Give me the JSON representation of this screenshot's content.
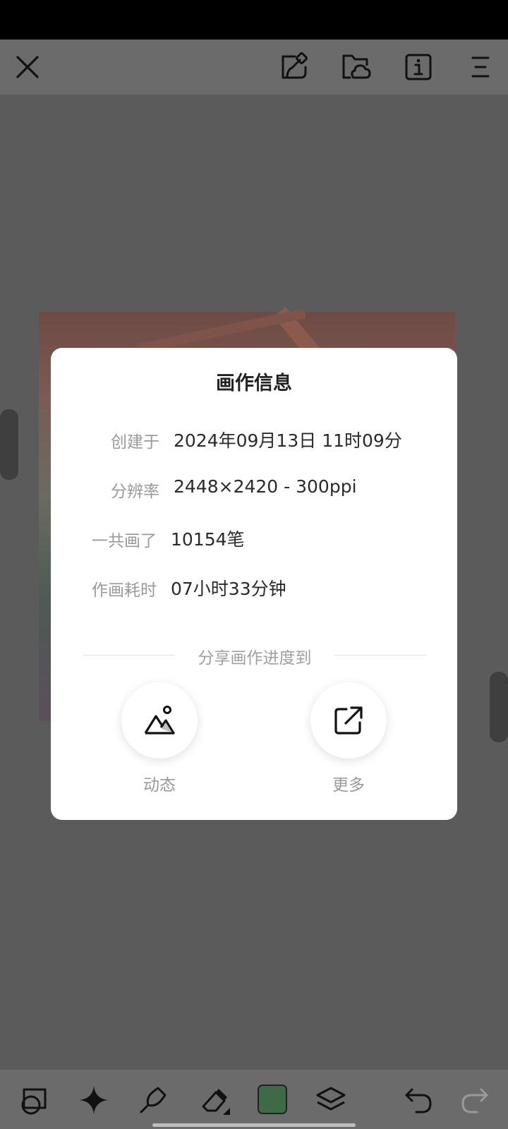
{
  "dialog": {
    "title": "画作信息",
    "rows": [
      {
        "label": "创建于",
        "value": "2024年09月13日 11时09分"
      },
      {
        "label": "分辨率",
        "value": "2448×2420 - 300ppi"
      },
      {
        "label": "一共画了",
        "value": "10154笔"
      },
      {
        "label": "作画耗时",
        "value": "07小时33分钟"
      }
    ],
    "share_heading": "分享画作进度到",
    "share_targets": [
      {
        "label": "动态",
        "icon": "mountain-image-icon"
      },
      {
        "label": "更多",
        "icon": "external-share-icon"
      }
    ]
  },
  "top_bar": {
    "icons": [
      "close-icon",
      "canvas-edit-icon",
      "cloud-folder-icon",
      "info-icon",
      "menu-icon"
    ]
  },
  "bottom_toolbar": {
    "icons": [
      "shapes-icon",
      "sparkle-icon",
      "brush-icon",
      "eraser-icon",
      "color-swatch",
      "layers-icon",
      "undo-icon",
      "redo-icon"
    ],
    "current_color": "#3e6b46"
  },
  "colors": {
    "overlay": "#5b5b5b",
    "dialog_bg": "#ffffff"
  }
}
